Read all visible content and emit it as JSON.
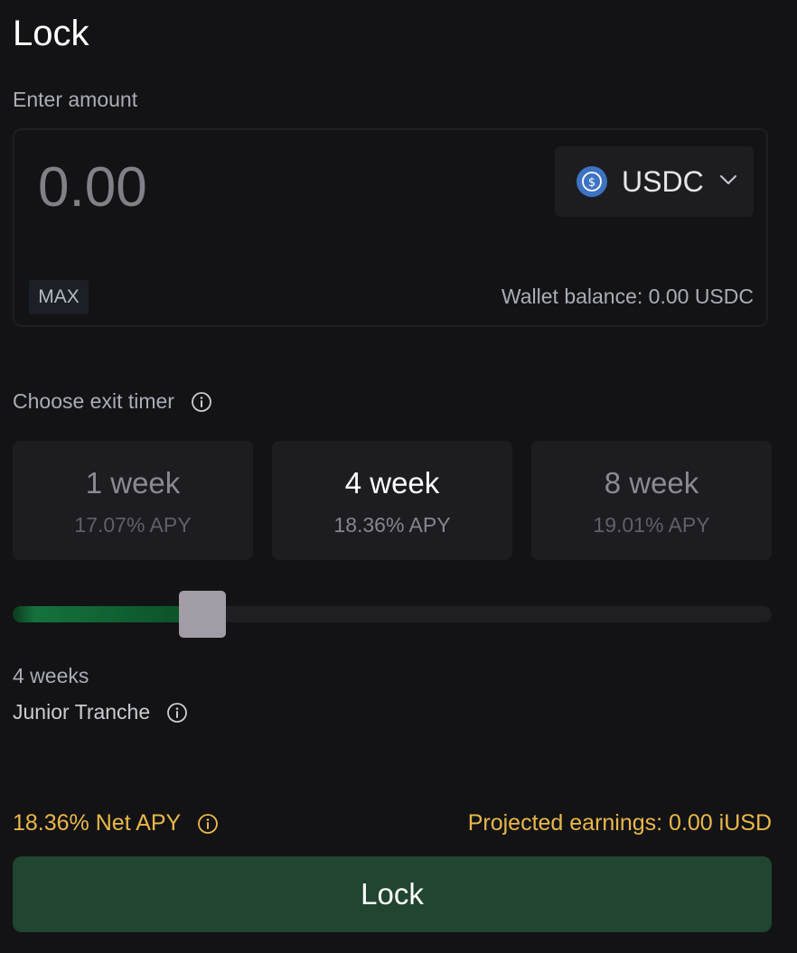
{
  "page": {
    "title": "Lock"
  },
  "amount": {
    "label": "Enter amount",
    "placeholder": "0.00",
    "max_label": "MAX",
    "wallet_balance": "Wallet balance: 0.00 USDC"
  },
  "token": {
    "symbol": "USDC",
    "icon": "usdc-icon",
    "icon_color": "#3e73c4"
  },
  "exit_timer": {
    "label": "Choose exit timer",
    "options": [
      {
        "label": "1 week",
        "apy": "17.07% APY",
        "selected": false
      },
      {
        "label": "4 week",
        "apy": "18.36% APY",
        "selected": true
      },
      {
        "label": "8 week",
        "apy": "19.01% APY",
        "selected": false
      }
    ]
  },
  "slider": {
    "value_fraction": 0.25,
    "duration_text": "4 weeks",
    "fill_color": "#14723c"
  },
  "tranche": {
    "label": "Junior Tranche"
  },
  "summary": {
    "net_apy": "18.36% Net APY",
    "projected_earnings": "Projected earnings: 0.00 iUSD",
    "accent_color": "#e9b84a"
  },
  "actions": {
    "lock_label": "Lock",
    "lock_color": "#204530"
  }
}
